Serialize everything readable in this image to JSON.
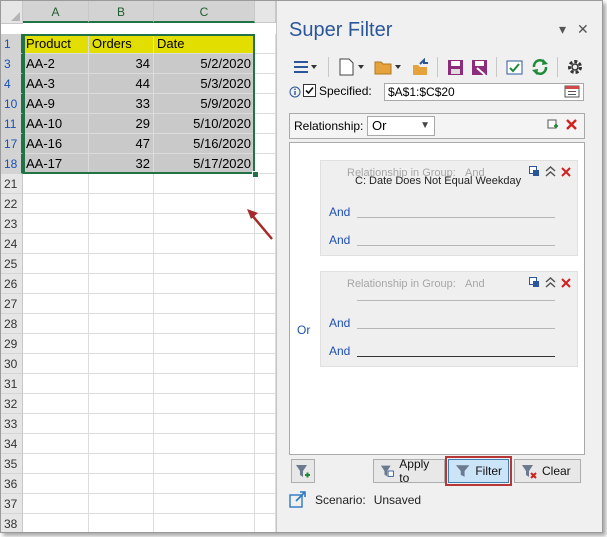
{
  "spreadsheet": {
    "columns": [
      "A",
      "B",
      "C"
    ],
    "header_row_num": "1",
    "header": [
      "Product",
      "Orders",
      "Date"
    ],
    "data_rows": [
      {
        "num": "3",
        "product": "AA-2",
        "orders": "34",
        "date": "5/2/2020"
      },
      {
        "num": "4",
        "product": "AA-3",
        "orders": "44",
        "date": "5/3/2020"
      },
      {
        "num": "10",
        "product": "AA-9",
        "orders": "33",
        "date": "5/9/2020"
      },
      {
        "num": "11",
        "product": "AA-10",
        "orders": "29",
        "date": "5/10/2020"
      },
      {
        "num": "17",
        "product": "AA-16",
        "orders": "47",
        "date": "5/16/2020"
      },
      {
        "num": "18",
        "product": "AA-17",
        "orders": "32",
        "date": "5/17/2020"
      }
    ],
    "empty_rows": [
      "21",
      "22",
      "23",
      "24",
      "25",
      "26",
      "27",
      "28",
      "29",
      "30",
      "31",
      "32",
      "33",
      "34",
      "35",
      "36",
      "37",
      "38"
    ],
    "colors": {
      "header_fill": "#e2de00",
      "data_fill": "#c9c9c9",
      "selection": "#217346",
      "arrow": "#a52a2a"
    }
  },
  "panel": {
    "title": "Super Filter",
    "controls": {
      "dropdown": "▾",
      "close": "✕"
    },
    "specified_label": "Specified:",
    "specified_checked": true,
    "range": "$A$1:$C$20",
    "relationship_label": "Relationship:",
    "relationship_value": "Or",
    "or_label": "Or",
    "groups": [
      {
        "header": "Relationship in Group:",
        "relation": "And",
        "conditions": [
          {
            "label": "",
            "text": "C: Date  Does Not Equal  Weekday"
          },
          {
            "label": "And",
            "text": ""
          },
          {
            "label": "And",
            "text": ""
          }
        ]
      },
      {
        "header": "Relationship in Group:",
        "relation": "And",
        "conditions": [
          {
            "label": "",
            "text": ""
          },
          {
            "label": "And",
            "text": ""
          },
          {
            "label": "And",
            "text": ""
          }
        ]
      }
    ],
    "buttons": {
      "apply_to": "Apply to",
      "filter": "Filter",
      "clear": "Clear"
    },
    "scenario_label": "Scenario:",
    "scenario_value": "Unsaved",
    "icons": [
      "menu-icon",
      "new-file-icon",
      "open-folder-icon",
      "save-icon",
      "save-as-icon",
      "export-icon",
      "refresh-icon",
      "settings-icon"
    ]
  }
}
